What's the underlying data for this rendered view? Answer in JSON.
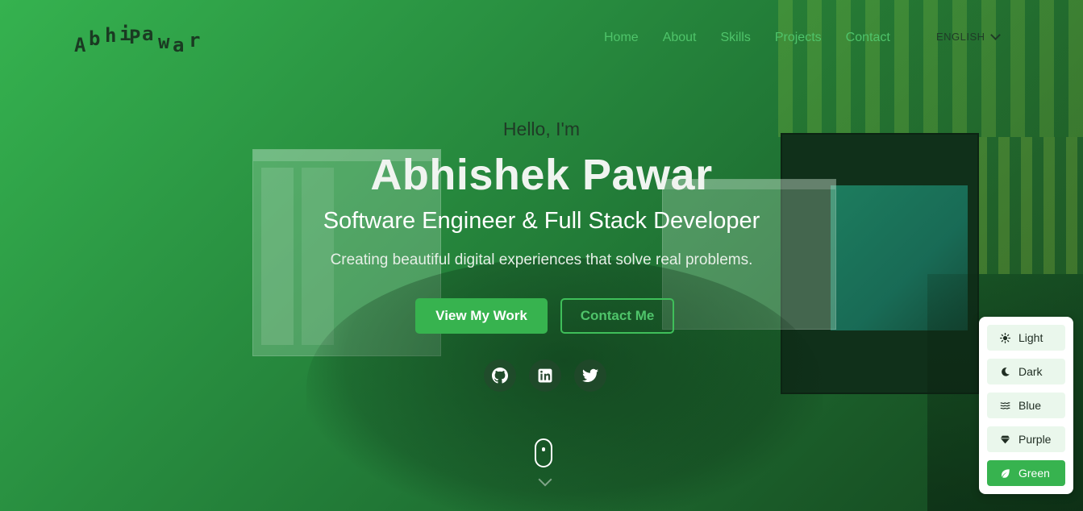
{
  "brand": {
    "logo_text": "AbhiPawar"
  },
  "nav": {
    "links": [
      "Home",
      "About",
      "Skills",
      "Projects",
      "Contact"
    ],
    "language": "ENGLISH"
  },
  "hero": {
    "greeting": "Hello, I'm",
    "name": "Abhishek Pawar",
    "role": "Software Engineer & Full Stack Developer",
    "tagline": "Creating beautiful digital experiences that solve real problems.",
    "primary_button": "View My Work",
    "secondary_button": "Contact Me"
  },
  "social": {
    "icons": [
      "github-icon",
      "linkedin-icon",
      "twitter-icon"
    ]
  },
  "theme_switcher": {
    "options": [
      {
        "label": "Light",
        "icon": "sun-icon"
      },
      {
        "label": "Dark",
        "icon": "moon-icon"
      },
      {
        "label": "Blue",
        "icon": "waves-icon"
      },
      {
        "label": "Purple",
        "icon": "gem-icon"
      },
      {
        "label": "Green",
        "icon": "leaf-icon"
      }
    ],
    "selected": "Green"
  },
  "colors": {
    "accent": "#37b34f",
    "nav_link": "#4fc46a",
    "panel_bg": "#ffffff"
  }
}
